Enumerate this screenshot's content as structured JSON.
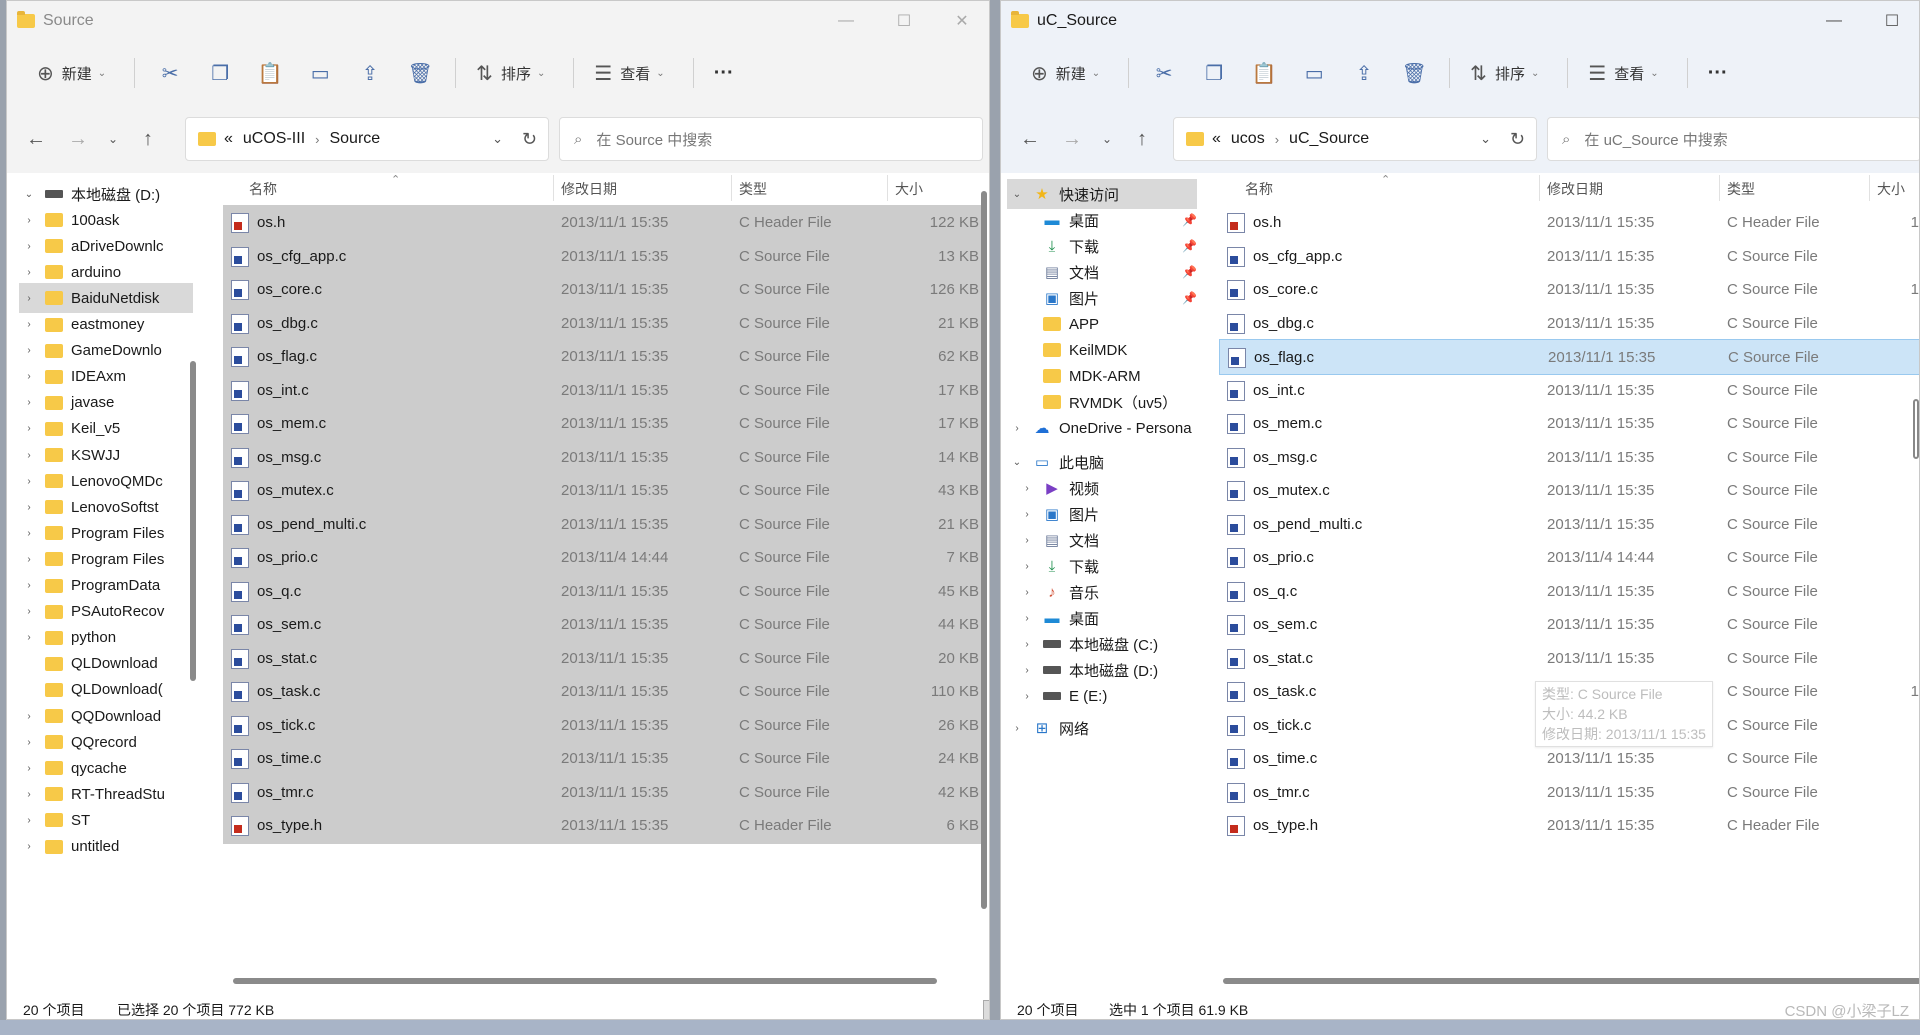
{
  "left": {
    "title": "Source",
    "toolbar": {
      "new": "新建",
      "sort": "排序",
      "view": "查看",
      "more": "···"
    },
    "address": {
      "overflow": "«",
      "crumbs": [
        "uCOS-III",
        "Source"
      ]
    },
    "search_placeholder": "在 Source 中搜索",
    "columns": {
      "name": "名称",
      "date": "修改日期",
      "type": "类型",
      "size": "大小"
    },
    "tree": [
      {
        "label": "本地磁盘 (D:)",
        "kind": "drive",
        "expanded": true
      },
      {
        "label": "100ask"
      },
      {
        "label": "aDriveDownlc"
      },
      {
        "label": "arduino"
      },
      {
        "label": "BaiduNetdisk",
        "selected": true
      },
      {
        "label": "eastmoney"
      },
      {
        "label": "GameDownlo"
      },
      {
        "label": "IDEAxm"
      },
      {
        "label": "javase"
      },
      {
        "label": "Keil_v5"
      },
      {
        "label": "KSWJJ"
      },
      {
        "label": "LenovoQMDc"
      },
      {
        "label": "LenovoSoftst"
      },
      {
        "label": "Program Files"
      },
      {
        "label": "Program Files"
      },
      {
        "label": "ProgramData"
      },
      {
        "label": "PSAutoRecov"
      },
      {
        "label": "python"
      },
      {
        "label": "QLDownload",
        "leaf": true
      },
      {
        "label": "QLDownload(",
        "leaf": true
      },
      {
        "label": "QQDownload"
      },
      {
        "label": "QQrecord"
      },
      {
        "label": "qycache"
      },
      {
        "label": "RT-ThreadStu"
      },
      {
        "label": "ST"
      },
      {
        "label": "untitled"
      }
    ],
    "files": [
      {
        "name": "os.h",
        "date": "2013/11/1 15:35",
        "type": "C Header File",
        "size": "122 KB",
        "h": true
      },
      {
        "name": "os_cfg_app.c",
        "date": "2013/11/1 15:35",
        "type": "C Source File",
        "size": "13 KB"
      },
      {
        "name": "os_core.c",
        "date": "2013/11/1 15:35",
        "type": "C Source File",
        "size": "126 KB"
      },
      {
        "name": "os_dbg.c",
        "date": "2013/11/1 15:35",
        "type": "C Source File",
        "size": "21 KB"
      },
      {
        "name": "os_flag.c",
        "date": "2013/11/1 15:35",
        "type": "C Source File",
        "size": "62 KB"
      },
      {
        "name": "os_int.c",
        "date": "2013/11/1 15:35",
        "type": "C Source File",
        "size": "17 KB"
      },
      {
        "name": "os_mem.c",
        "date": "2013/11/1 15:35",
        "type": "C Source File",
        "size": "17 KB"
      },
      {
        "name": "os_msg.c",
        "date": "2013/11/1 15:35",
        "type": "C Source File",
        "size": "14 KB"
      },
      {
        "name": "os_mutex.c",
        "date": "2013/11/1 15:35",
        "type": "C Source File",
        "size": "43 KB"
      },
      {
        "name": "os_pend_multi.c",
        "date": "2013/11/1 15:35",
        "type": "C Source File",
        "size": "21 KB"
      },
      {
        "name": "os_prio.c",
        "date": "2013/11/4 14:44",
        "type": "C Source File",
        "size": "7 KB"
      },
      {
        "name": "os_q.c",
        "date": "2013/11/1 15:35",
        "type": "C Source File",
        "size": "45 KB"
      },
      {
        "name": "os_sem.c",
        "date": "2013/11/1 15:35",
        "type": "C Source File",
        "size": "44 KB"
      },
      {
        "name": "os_stat.c",
        "date": "2013/11/1 15:35",
        "type": "C Source File",
        "size": "20 KB"
      },
      {
        "name": "os_task.c",
        "date": "2013/11/1 15:35",
        "type": "C Source File",
        "size": "110 KB"
      },
      {
        "name": "os_tick.c",
        "date": "2013/11/1 15:35",
        "type": "C Source File",
        "size": "26 KB"
      },
      {
        "name": "os_time.c",
        "date": "2013/11/1 15:35",
        "type": "C Source File",
        "size": "24 KB"
      },
      {
        "name": "os_tmr.c",
        "date": "2013/11/1 15:35",
        "type": "C Source File",
        "size": "42 KB"
      },
      {
        "name": "os_type.h",
        "date": "2013/11/1 15:35",
        "type": "C Header File",
        "size": "6 KB",
        "h": true
      }
    ],
    "status": {
      "count": "20 个项目",
      "selection": "已选择 20 个项目  772 KB"
    }
  },
  "right": {
    "title": "uC_Source",
    "toolbar": {
      "new": "新建",
      "sort": "排序",
      "view": "查看",
      "more": "···"
    },
    "address": {
      "overflow": "«",
      "crumbs": [
        "ucos",
        "uC_Source"
      ]
    },
    "search_placeholder": "在 uC_Source 中搜索",
    "columns": {
      "name": "名称",
      "date": "修改日期",
      "type": "类型",
      "size": "大小"
    },
    "tree": [
      {
        "label": "快速访问",
        "kind": "star",
        "expanded": true,
        "selected": true
      },
      {
        "label": "桌面",
        "kind": "desktop",
        "pin": true,
        "indent": 1
      },
      {
        "label": "下载",
        "kind": "download",
        "pin": true,
        "indent": 1
      },
      {
        "label": "文档",
        "kind": "doc",
        "pin": true,
        "indent": 1
      },
      {
        "label": "图片",
        "kind": "pic",
        "pin": true,
        "indent": 1
      },
      {
        "label": "APP",
        "indent": 1
      },
      {
        "label": "KeilMDK",
        "indent": 1
      },
      {
        "label": "MDK-ARM",
        "indent": 1
      },
      {
        "label": "RVMDK（uv5）",
        "indent": 1
      },
      {
        "label": "OneDrive - Persona",
        "kind": "cloud",
        "collapsed": true
      },
      {
        "label": "此电脑",
        "kind": "pc",
        "expanded": true
      },
      {
        "label": "视频",
        "kind": "video",
        "collapsed": true,
        "indent": 1
      },
      {
        "label": "图片",
        "kind": "pic",
        "collapsed": true,
        "indent": 1
      },
      {
        "label": "文档",
        "kind": "doc",
        "collapsed": true,
        "indent": 1
      },
      {
        "label": "下载",
        "kind": "download",
        "collapsed": true,
        "indent": 1
      },
      {
        "label": "音乐",
        "kind": "music",
        "collapsed": true,
        "indent": 1
      },
      {
        "label": "桌面",
        "kind": "desktop",
        "collapsed": true,
        "indent": 1
      },
      {
        "label": "本地磁盘 (C:)",
        "kind": "drive",
        "collapsed": true,
        "indent": 1
      },
      {
        "label": "本地磁盘 (D:)",
        "kind": "drive",
        "collapsed": true,
        "indent": 1
      },
      {
        "label": "E (E:)",
        "kind": "drive",
        "collapsed": true,
        "indent": 1
      },
      {
        "label": "网络",
        "kind": "net",
        "collapsed": true
      }
    ],
    "files": [
      {
        "name": "os.h",
        "date": "2013/11/1 15:35",
        "type": "C Header File",
        "size": "1",
        "h": true
      },
      {
        "name": "os_cfg_app.c",
        "date": "2013/11/1 15:35",
        "type": "C Source File",
        "size": ""
      },
      {
        "name": "os_core.c",
        "date": "2013/11/1 15:35",
        "type": "C Source File",
        "size": "1"
      },
      {
        "name": "os_dbg.c",
        "date": "2013/11/1 15:35",
        "type": "C Source File",
        "size": ""
      },
      {
        "name": "os_flag.c",
        "date": "2013/11/1 15:35",
        "type": "C Source File",
        "size": "",
        "selected": true
      },
      {
        "name": "os_int.c",
        "date": "2013/11/1 15:35",
        "type": "C Source File",
        "size": ""
      },
      {
        "name": "os_mem.c",
        "date": "2013/11/1 15:35",
        "type": "C Source File",
        "size": ""
      },
      {
        "name": "os_msg.c",
        "date": "2013/11/1 15:35",
        "type": "C Source File",
        "size": ""
      },
      {
        "name": "os_mutex.c",
        "date": "2013/11/1 15:35",
        "type": "C Source File",
        "size": ""
      },
      {
        "name": "os_pend_multi.c",
        "date": "2013/11/1 15:35",
        "type": "C Source File",
        "size": ""
      },
      {
        "name": "os_prio.c",
        "date": "2013/11/4 14:44",
        "type": "C Source File",
        "size": ""
      },
      {
        "name": "os_q.c",
        "date": "2013/11/1 15:35",
        "type": "C Source File",
        "size": ""
      },
      {
        "name": "os_sem.c",
        "date": "2013/11/1 15:35",
        "type": "C Source File",
        "size": ""
      },
      {
        "name": "os_stat.c",
        "date": "2013/11/1 15:35",
        "type": "C Source File",
        "size": ""
      },
      {
        "name": "os_task.c",
        "date": "2013/11/1 15:35",
        "type": "C Source File",
        "size": "1"
      },
      {
        "name": "os_tick.c",
        "date": "2013/11/1 15:35",
        "type": "C Source File",
        "size": ""
      },
      {
        "name": "os_time.c",
        "date": "2013/11/1 15:35",
        "type": "C Source File",
        "size": ""
      },
      {
        "name": "os_tmr.c",
        "date": "2013/11/1 15:35",
        "type": "C Source File",
        "size": ""
      },
      {
        "name": "os_type.h",
        "date": "2013/11/1 15:35",
        "type": "C Header File",
        "size": "",
        "h": true
      }
    ],
    "tooltip": [
      "类型: C Source File",
      "大小: 44.2 KB",
      "修改日期: 2013/11/1 15:35"
    ],
    "status": {
      "count": "20 个项目",
      "selection": "选中 1 个项目  61.9 KB"
    }
  },
  "watermark": "CSDN @小梁子LZ",
  "colors": {
    "selected_row": "#cce4f7",
    "left_row_bg": "#cccccc",
    "folder": "#f7c948"
  }
}
